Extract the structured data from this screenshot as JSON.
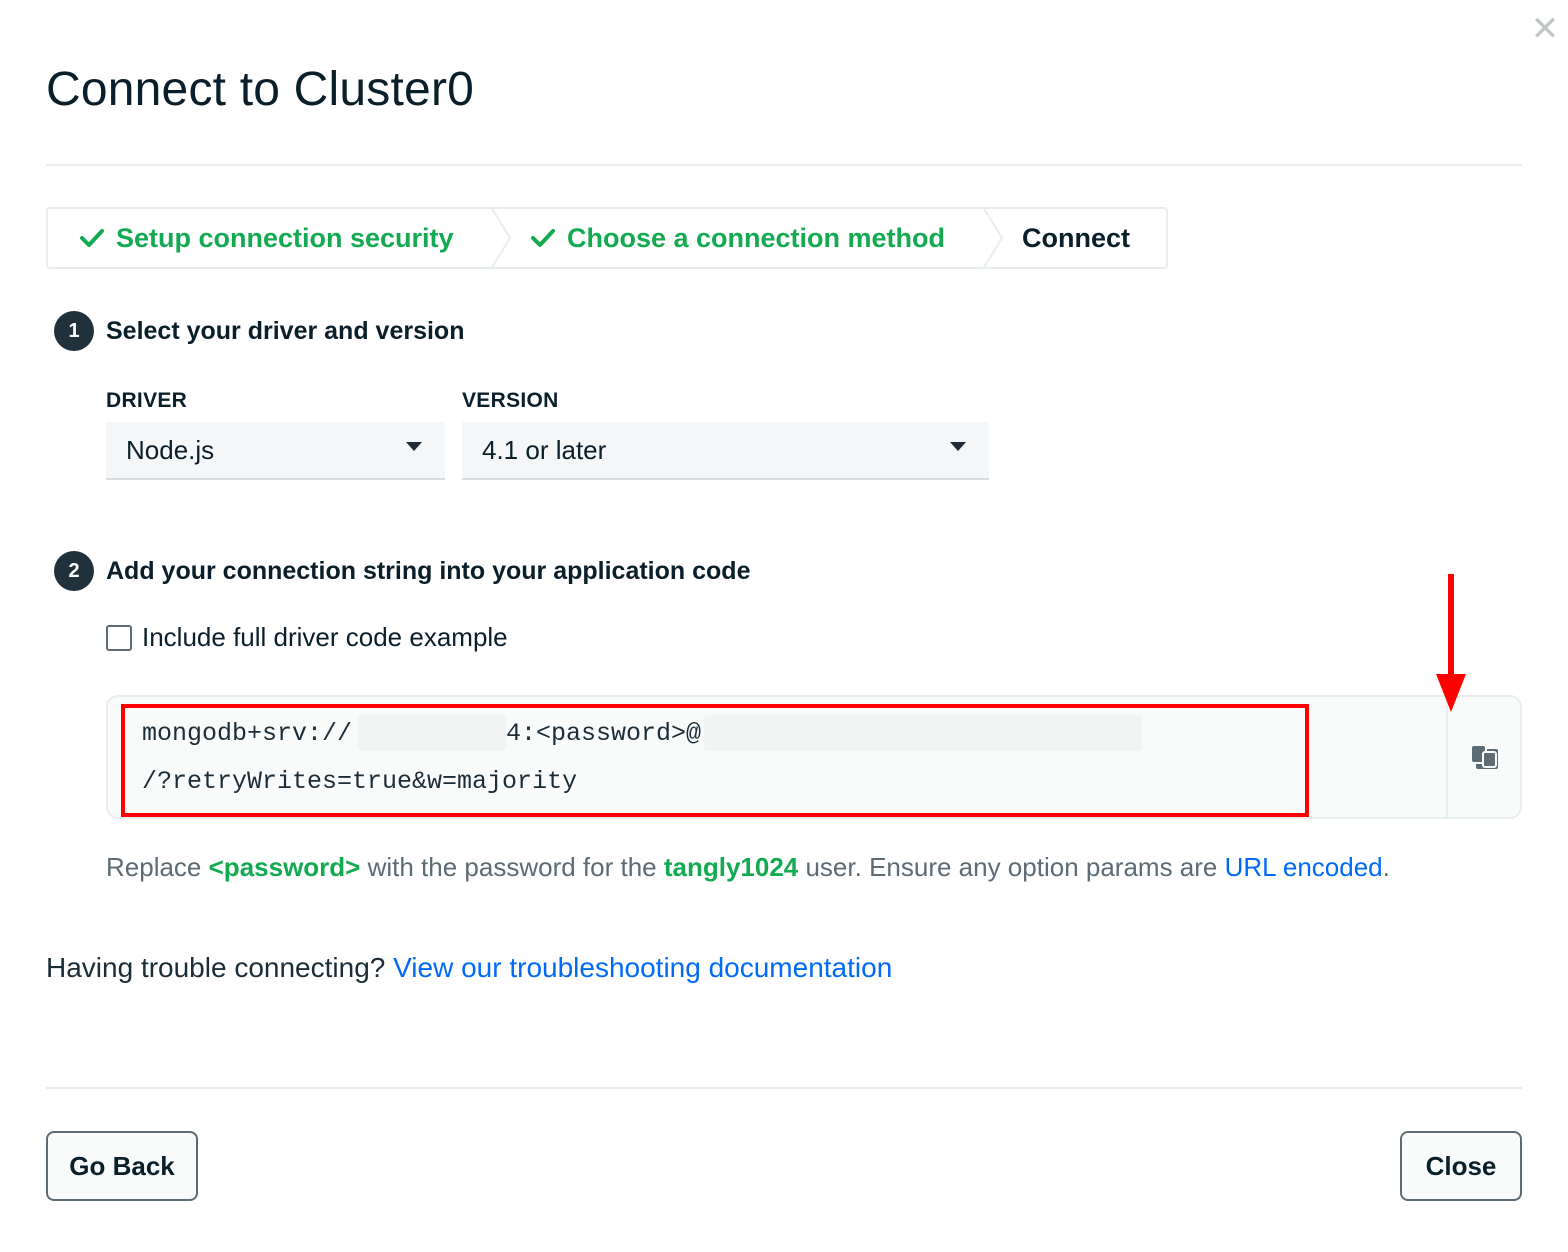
{
  "dialog": {
    "title": "Connect to Cluster0",
    "close_glyph": "✕"
  },
  "stepper": {
    "steps": [
      {
        "label": "Setup connection security",
        "state": "done"
      },
      {
        "label": "Choose a connection method",
        "state": "done"
      },
      {
        "label": "Connect",
        "state": "current"
      }
    ]
  },
  "section1": {
    "number": "1",
    "title": "Select your driver and version",
    "driver_label": "DRIVER",
    "driver_value": "Node.js",
    "version_label": "VERSION",
    "version_value": "4.1 or later"
  },
  "section2": {
    "number": "2",
    "title": "Add your connection string into your application code",
    "checkbox_label": "Include full driver code example",
    "code_line1_a": "mongodb+srv://",
    "code_line1_b": "4:<password>@",
    "code_line2": "/?retryWrites=true&w=majority",
    "copy_icon": "copy-icon"
  },
  "note": {
    "prefix": "Replace ",
    "password_token": "<password>",
    "middle": " with the password for the ",
    "username": "tangly1024",
    "suffix": " user. Ensure any option params are ",
    "link": "URL encoded",
    "end": "."
  },
  "help": {
    "question": "Having trouble connecting? ",
    "link": "View our troubleshooting documentation"
  },
  "footer": {
    "back_label": "Go Back",
    "close_label": "Close"
  },
  "colors": {
    "success_green": "#13aa52",
    "link_blue": "#016bf8",
    "annotation_red": "#ff0000"
  }
}
